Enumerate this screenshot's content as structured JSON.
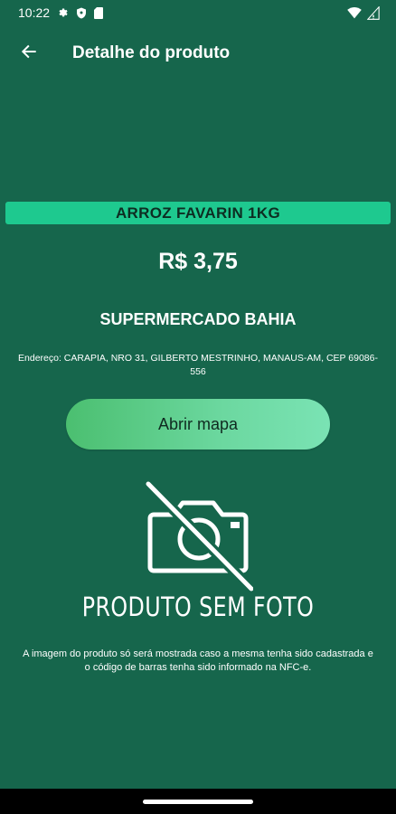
{
  "status_bar": {
    "time": "10:22",
    "icons": [
      "gear-icon",
      "shield-icon",
      "sim-card-icon",
      "wifi-icon",
      "cellular-signal-icon"
    ]
  },
  "app_bar": {
    "title": "Detalhe do produto",
    "back_icon": "arrow-left-icon"
  },
  "product": {
    "name": "ARROZ FAVARIN 1KG",
    "price": "R$ 3,75"
  },
  "store": {
    "name": "SUPERMERCADO BAHIA",
    "address": "Endereço: CARAPIA, NRO 31, GILBERTO MESTRINHO, MANAUS-AM, CEP 69086-556"
  },
  "map_button": {
    "label": "Abrir mapa"
  },
  "no_photo": {
    "icon": "camera-off-icon",
    "label": "PRODUTO SEM FOTO",
    "note": "A imagem do produto só será mostrada caso a mesma tenha sido cadastrada e o código de barras tenha sido informado na NFC-e."
  },
  "colors": {
    "background": "#16664c",
    "product_band": "#1ec98f",
    "button_gradient_start": "#4bbf70",
    "button_gradient_end": "#7ae3b4"
  }
}
